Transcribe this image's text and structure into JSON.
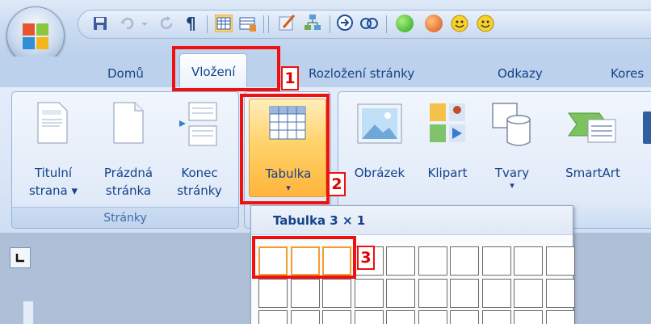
{
  "tabs": [
    {
      "label": "Domů",
      "active": false
    },
    {
      "label": "Vložení",
      "active": true
    },
    {
      "label": "Rozložení stránky",
      "active": false
    },
    {
      "label": "Odkazy",
      "active": false
    },
    {
      "label": "Kores",
      "active": false
    }
  ],
  "groups": {
    "pages": {
      "title": "Stránky",
      "buttons": [
        {
          "line1": "Titulní",
          "line2": "strana ▾",
          "icon": "cover-page-icon"
        },
        {
          "line1": "Prázdná",
          "line2": "stránka",
          "icon": "blank-page-icon"
        },
        {
          "line1": "Konec",
          "line2": "stránky",
          "icon": "page-break-icon"
        }
      ]
    },
    "tables": {
      "buttons": [
        {
          "line1": "Tabulka",
          "line2": "▾",
          "icon": "table-icon"
        }
      ]
    },
    "illustrations": {
      "buttons": [
        {
          "line1": "Obrázek",
          "icon": "picture-icon"
        },
        {
          "line1": "Klipart",
          "icon": "clipart-icon"
        },
        {
          "line1": "Tvary",
          "line2": "▾",
          "icon": "shapes-icon"
        },
        {
          "line1": "SmartArt",
          "icon": "smartart-icon"
        }
      ]
    }
  },
  "dropdown": {
    "title": "Tabulka 3 × 1",
    "selected_cols": 3,
    "selected_rows": 1
  },
  "annotations": [
    "1",
    "2",
    "3"
  ],
  "colors": {
    "accent": "#15428b",
    "highlight": "#f39c2e",
    "annotation": "#e11111"
  }
}
